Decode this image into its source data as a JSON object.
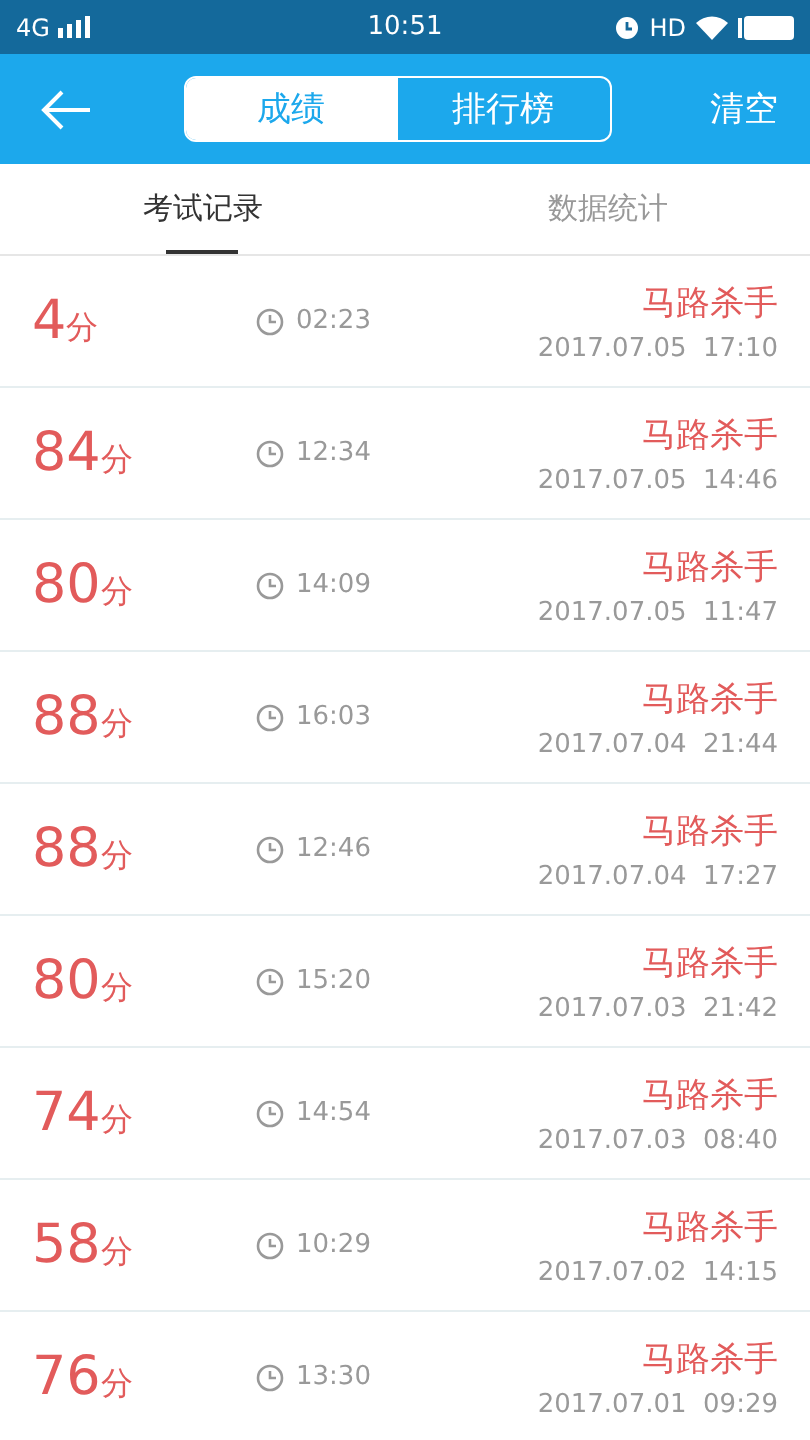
{
  "status_bar": {
    "network": "4G",
    "time": "10:51",
    "hd": "HD"
  },
  "header": {
    "segments": [
      {
        "label": "成绩",
        "selected": true
      },
      {
        "label": "排行榜",
        "selected": false
      }
    ],
    "action": "清空"
  },
  "tabs": [
    {
      "label": "考试记录",
      "selected": true
    },
    {
      "label": "数据统计",
      "selected": false
    }
  ],
  "records": [
    {
      "score": "4",
      "unit": "分",
      "duration": "02:23",
      "name": "马路杀手",
      "date": "2017.07.05  17:10"
    },
    {
      "score": "84",
      "unit": "分",
      "duration": "12:34",
      "name": "马路杀手",
      "date": "2017.07.05  14:46"
    },
    {
      "score": "80",
      "unit": "分",
      "duration": "14:09",
      "name": "马路杀手",
      "date": "2017.07.05  11:47"
    },
    {
      "score": "88",
      "unit": "分",
      "duration": "16:03",
      "name": "马路杀手",
      "date": "2017.07.04  21:44"
    },
    {
      "score": "88",
      "unit": "分",
      "duration": "12:46",
      "name": "马路杀手",
      "date": "2017.07.04  17:27"
    },
    {
      "score": "80",
      "unit": "分",
      "duration": "15:20",
      "name": "马路杀手",
      "date": "2017.07.03  21:42"
    },
    {
      "score": "74",
      "unit": "分",
      "duration": "14:54",
      "name": "马路杀手",
      "date": "2017.07.03  08:40"
    },
    {
      "score": "58",
      "unit": "分",
      "duration": "10:29",
      "name": "马路杀手",
      "date": "2017.07.02  14:15"
    },
    {
      "score": "76",
      "unit": "分",
      "duration": "13:30",
      "name": "马路杀手",
      "date": "2017.07.01  09:29"
    }
  ]
}
